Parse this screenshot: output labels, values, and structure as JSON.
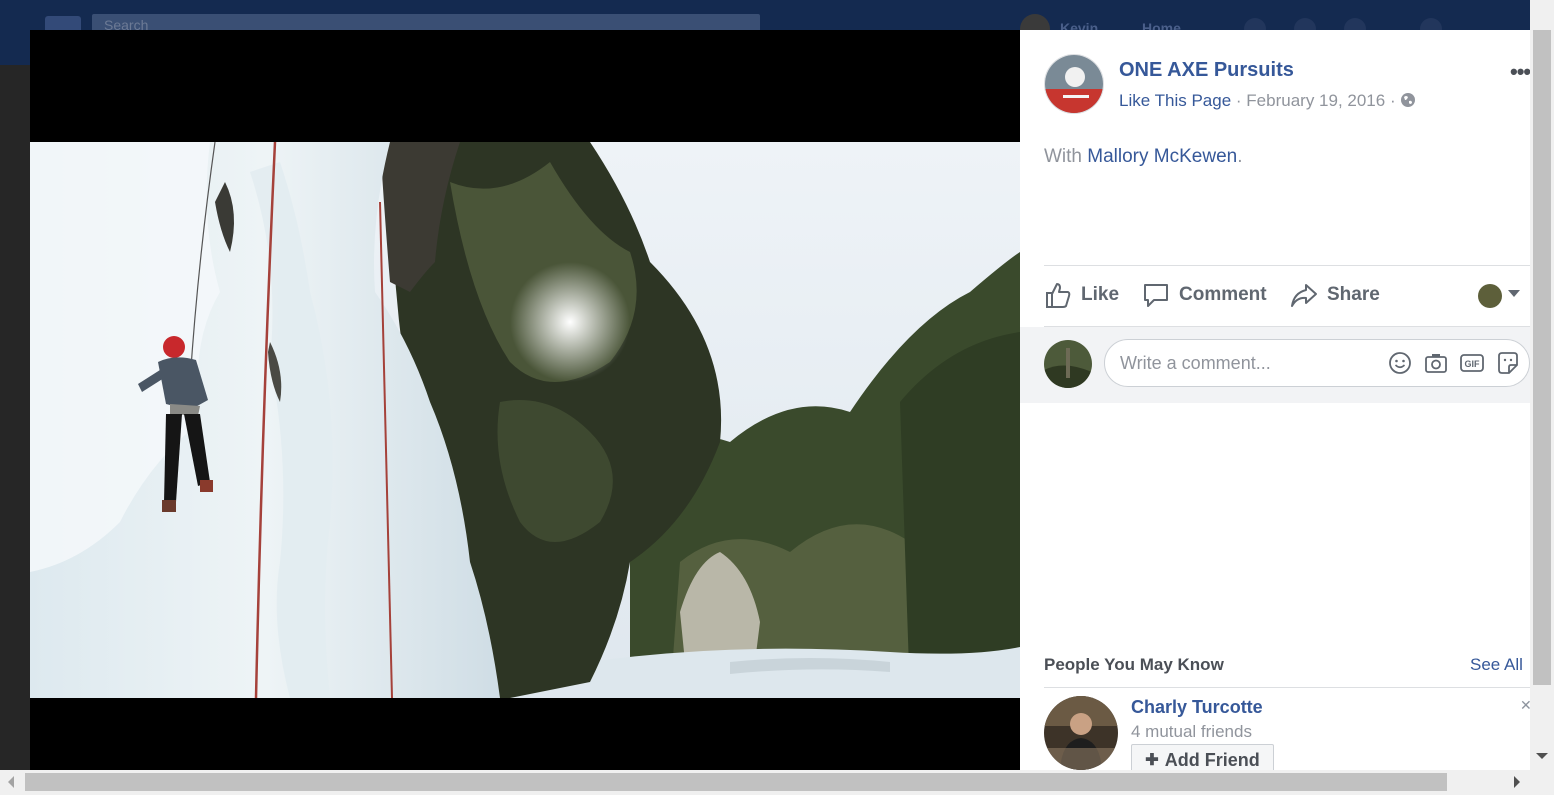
{
  "topbar": {
    "search_placeholder": "Search",
    "user": "Kevin",
    "home": "Home"
  },
  "post": {
    "page_name": "ONE AXE Pursuits",
    "like_page": "Like This Page",
    "separator": "·",
    "date": "February 19, 2016",
    "with_prefix": "With",
    "tagged_person": "Mallory McKewen",
    "tagged_suffix": ".",
    "more_icon": "more-options-icon",
    "privacy_icon": "globe-icon",
    "photo_alt": "Ice climber on a frozen waterfall beside a wooded river gorge"
  },
  "actions": {
    "like": "Like",
    "comment": "Comment",
    "share": "Share"
  },
  "comment_box": {
    "placeholder": "Write a comment...",
    "icons": [
      "emoji-icon",
      "camera-icon",
      "gif-icon",
      "sticker-icon"
    ],
    "gif_text": "GIF"
  },
  "pymk": {
    "title": "People You May Know",
    "see_all": "See All",
    "person": {
      "name": "Charly Turcotte",
      "mutual": "4 mutual friends",
      "add_friend": "Add Friend"
    }
  },
  "colors": {
    "link": "#365899",
    "secondary_text": "#90949c",
    "topbar": "#142a50"
  }
}
